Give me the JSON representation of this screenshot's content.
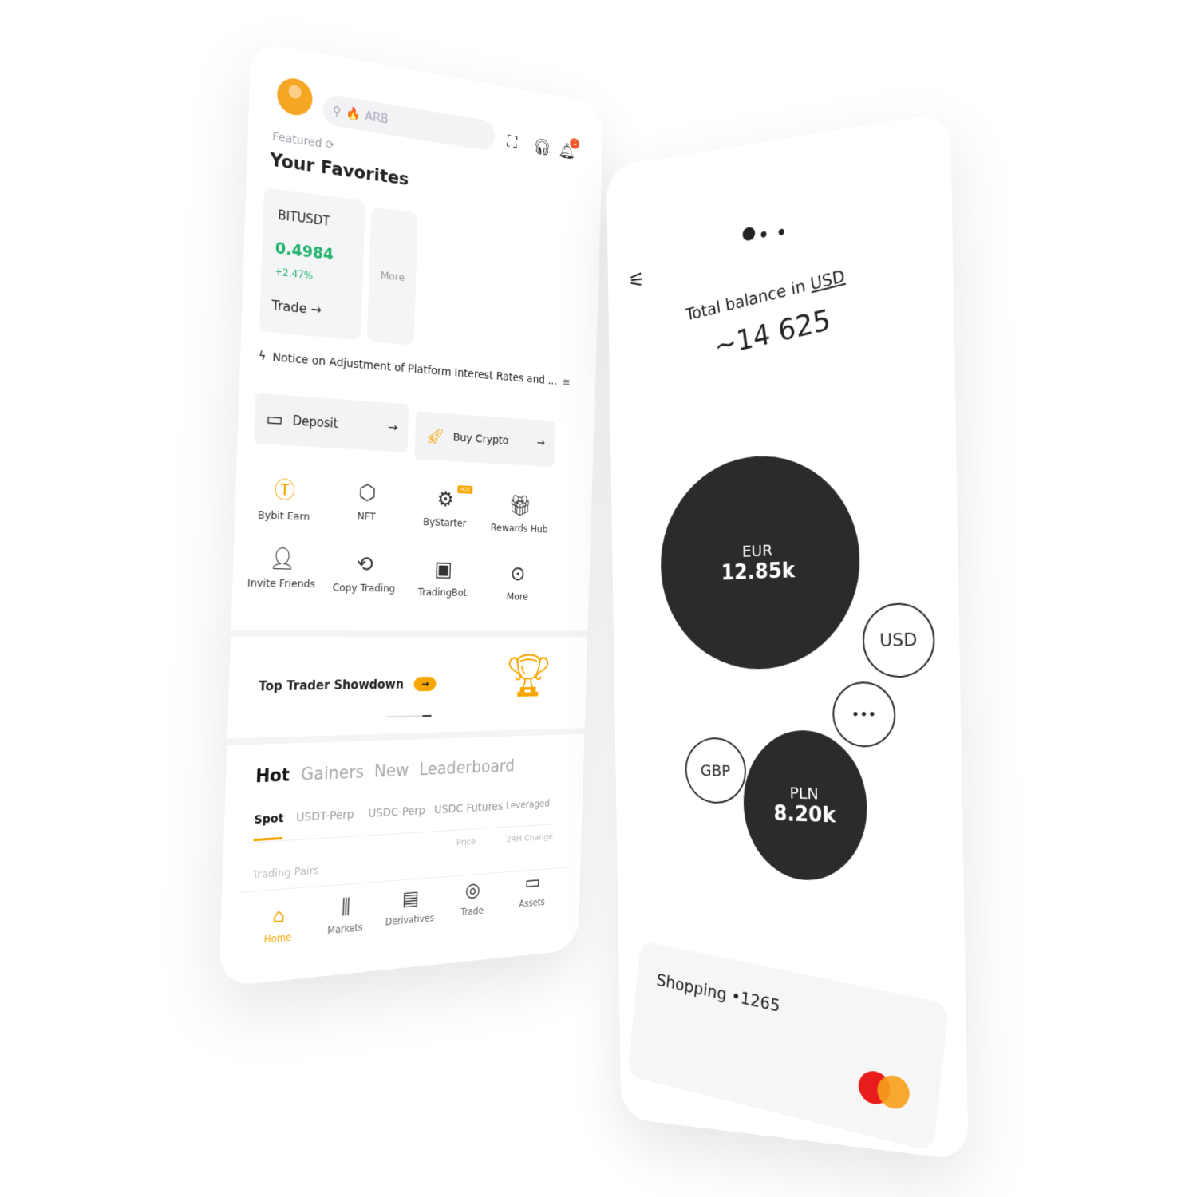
{
  "exchange": {
    "search": {
      "placeholder": "ARB"
    },
    "featured_label": "Featured",
    "notification_count": "1",
    "favorites_title": "Your Favorites",
    "favorite_card": {
      "pair": "BITUSDT",
      "price": "0.4984",
      "change": "+2.47%",
      "trade_label": "Trade"
    },
    "more_card_label": "More",
    "notice": "Notice on Adjustment of Platform Interest Rates and ...",
    "actions": {
      "deposit": "Deposit",
      "buy_crypto": "Buy Crypto"
    },
    "grid": [
      {
        "label": "Bybit Earn",
        "icon": "earn-icon"
      },
      {
        "label": "NFT",
        "icon": "nft-icon"
      },
      {
        "label": "ByStarter",
        "icon": "bystarter-icon",
        "badge": "HOT"
      },
      {
        "label": "Rewards Hub",
        "icon": "rewards-icon"
      },
      {
        "label": "Invite Friends",
        "icon": "invite-icon"
      },
      {
        "label": "Copy Trading",
        "icon": "copy-trading-icon"
      },
      {
        "label": "TradingBot",
        "icon": "bot-icon"
      },
      {
        "label": "More",
        "icon": "more-icon"
      }
    ],
    "banner": {
      "title": "Top Trader Showdown"
    },
    "market_tabs": [
      "Hot",
      "Gainers",
      "New",
      "Leaderboard"
    ],
    "market_subtabs": [
      "Spot",
      "USDT-Perp",
      "USDC-Perp",
      "USDC Futures",
      "Leveraged"
    ],
    "columns": {
      "pairs": "Trading Pairs",
      "price": "Price",
      "change": "24H Change"
    },
    "bottom_nav": [
      "Home",
      "Markets",
      "Derivatives",
      "Trade",
      "Assets"
    ],
    "colors": {
      "accent": "#f7a600",
      "positive": "#20b26c"
    }
  },
  "wallet": {
    "balance_label_prefix": "Total balance in",
    "balance_currency": "USD",
    "balance_value": "~14 625",
    "bubbles": [
      {
        "code": "EUR",
        "amount": "12.85k"
      },
      {
        "code": "USD"
      },
      {
        "code": "•••"
      },
      {
        "code": "GBP"
      },
      {
        "code": "PLN",
        "amount": "8.20k"
      }
    ],
    "card": {
      "name": "Shopping",
      "number": "•1265"
    }
  }
}
